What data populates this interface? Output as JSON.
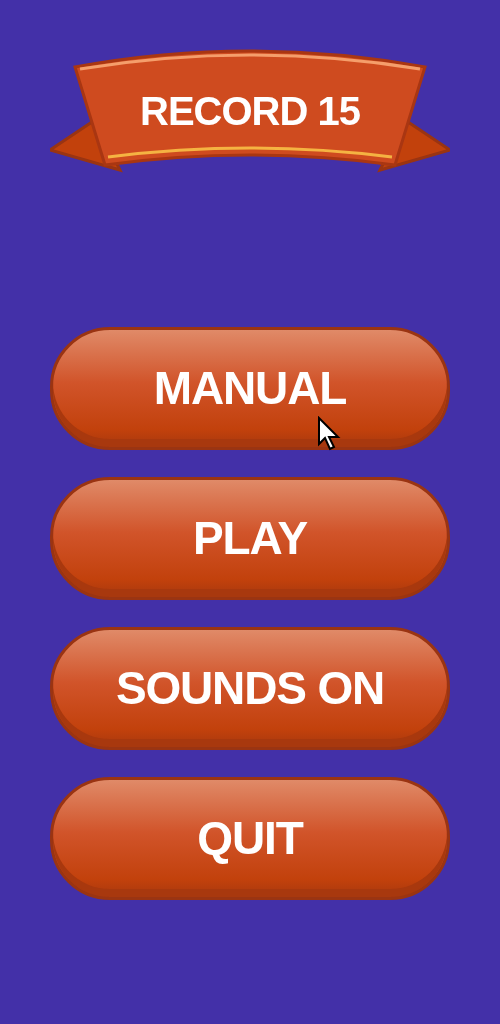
{
  "banner": {
    "text": "RECORD 15"
  },
  "menu": [
    {
      "label": "MANUAL"
    },
    {
      "label": "PLAY"
    },
    {
      "label": "SOUNDS ON"
    },
    {
      "label": "QUIT"
    }
  ]
}
